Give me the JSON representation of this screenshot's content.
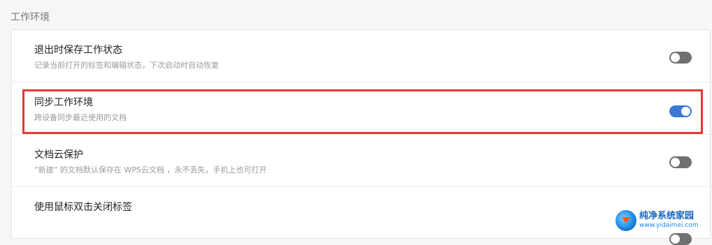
{
  "section": {
    "title": "工作环境"
  },
  "settings": [
    {
      "title": "退出时保存工作状态",
      "subtitle": "记录当前打开的标签和编辑状态，下次启动时自动恢复",
      "enabled": false
    },
    {
      "title": "同步工作环境",
      "subtitle": "跨设备同步最近使用的文档",
      "enabled": true
    },
    {
      "title": "文档云保护",
      "subtitle": "“新建” 的文档默认保存在 WPS云文档 ，永不丢失，手机上也可打开",
      "enabled": false
    },
    {
      "title": "使用鼠标双击关闭标签",
      "subtitle": "",
      "enabled": false
    }
  ],
  "colors": {
    "toggle_on": "#3b78d6",
    "toggle_off": "#707070",
    "highlight": "#e53935"
  },
  "watermark": {
    "name": "纯净系统家园",
    "url": "www.yidaimei.com"
  }
}
